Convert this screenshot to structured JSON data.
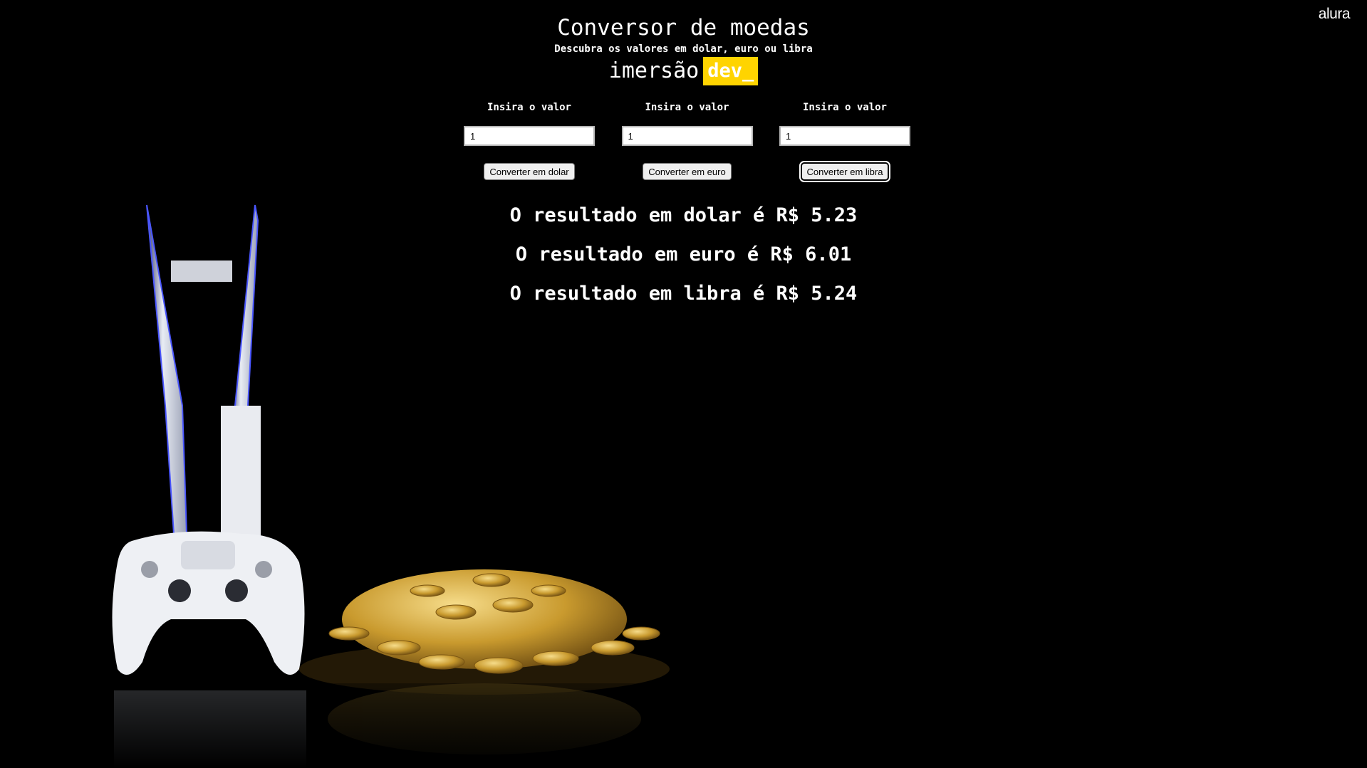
{
  "brand": "alura",
  "header": {
    "title": "Conversor de moedas",
    "subtitle": "Descubra os valores em dolar, euro ou libra",
    "logo_light": "imersão",
    "logo_box": "dev_"
  },
  "converters": [
    {
      "label": "Insira o valor",
      "value": "1",
      "button": "Converter em dolar"
    },
    {
      "label": "Insira o valor",
      "value": "1",
      "button": "Converter em euro"
    },
    {
      "label": "Insira o valor",
      "value": "1",
      "button": "Converter em libra"
    }
  ],
  "results": [
    "O resultado em dolar é R$ 5.23",
    "O resultado em euro é R$ 6.01",
    "O resultado em libra é R$ 5.24"
  ],
  "colors": {
    "background": "#000000",
    "text": "#ffffff",
    "logo_accent": "#ffd400"
  }
}
